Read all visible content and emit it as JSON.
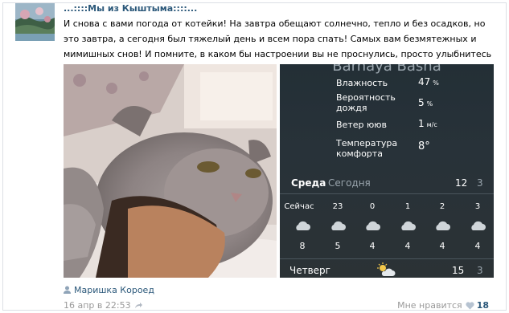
{
  "post": {
    "group_title": "...::::Мы из Кыштыма::::...",
    "text": "И снова с вами погода от котейки! На завтра обещают солнечно, тепло и без осадков, но это завтра, а сегодня был тяжелый день и всем пора спать! Самых вам безмятежных и мимишных снов! И помните, в каком бы настроении вы не проснулись, просто улыбнитесь новому дню!"
  },
  "weather": {
    "header": "Barnaya Basna",
    "rows": [
      {
        "label": "Влажность",
        "value": "47",
        "unit": "%"
      },
      {
        "label": "Вероятность дождя",
        "value": "5",
        "unit": "%"
      },
      {
        "label": "Ветер ююв",
        "value": "1",
        "unit": "м/с"
      },
      {
        "label": "Температура комфорта",
        "value": "8°",
        "unit": ""
      }
    ],
    "day": "Среда",
    "day_sub": "Сегодня",
    "day_high": "12",
    "day_low": "3",
    "hours": [
      "Сейчас",
      "23",
      "0",
      "1",
      "2",
      "3"
    ],
    "temps": [
      "8",
      "5",
      "4",
      "4",
      "4",
      "4"
    ],
    "next_day": "Четверг",
    "next_high": "15",
    "next_low": "3"
  },
  "footer": {
    "author": "Маришка Короед",
    "date": "16 апр в 22:53",
    "like_label": "Мне нравится",
    "like_count": "18"
  },
  "colors": {
    "link": "#2b587a",
    "muted": "#999999",
    "weather_bg": "#283239"
  },
  "icons": [
    "user-icon",
    "share-arrow-icon",
    "heart-icon",
    "cloud-icon",
    "sun-cloud-icon"
  ]
}
